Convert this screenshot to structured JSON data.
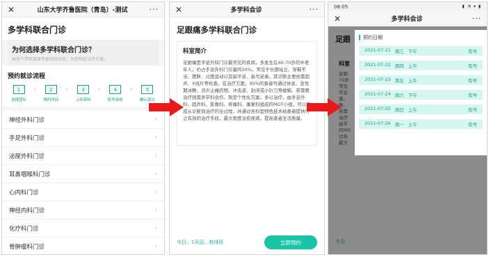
{
  "panel1": {
    "window_title": "山东大学齐鲁医院（青岛）-测试",
    "page_title": "多学科联合门诊",
    "why": {
      "question": "为何选择多学科联合门诊？",
      "desc": "由多个学科资深专家共同讨论，为您制定诊疗方案。"
    },
    "flow": {
      "title": "预约就诊流程",
      "steps": [
        {
          "num": "1",
          "label": "选择团队"
        },
        {
          "num": "2",
          "label": "预约时间"
        },
        {
          "num": "3",
          "label": "上传资料"
        },
        {
          "num": "4",
          "label": "轮号审核"
        },
        {
          "num": "5",
          "label": "确认就诊"
        }
      ],
      "arrow": "»"
    },
    "departments": [
      "神经外科门诊",
      "手足外科门诊",
      "泌尿外科门诊",
      "耳鼻咽喉科门诊",
      "心内科门诊",
      "神经内科门诊",
      "化疗科门诊",
      "骨肿瘤科门诊"
    ],
    "chevron": "›"
  },
  "panel2": {
    "window_title": "多学科会诊",
    "page_title": "足跟痛多学科联合门诊",
    "card_heading": "科室简介",
    "card_text": "足跟痛是手足外科门诊最常见的疾病，多发生在40-70岁的中老年人，约占手足外科门诊量的20%。常见于长期站立、穿鞋不当、肥胖、过度运动以及扁平足、高弓足者。其诊断主要依靠超声、X线片等检查。在治疗方面，95%的患者可通过休息、急性期冰敷、消炎止痛药物、冲击波、封闭或小针刀等缓解。若需要治疗则需多学科合作，制定个性化方案，多以治疗。由手足外科、超声科、影像科、疼痛科、康复科组成的MDT小组，可以完成从诊断到治疗的全过程，并通过各科室特色技术给患者提供行之有效的治疗手段，最大限度治愈疾病，提高患者生活质量。",
    "footer_hint": "今日、1天后...有排班",
    "book_button": "立即预约"
  },
  "panel3": {
    "status_time": "08:05",
    "status_icons": "▮ ◔ ▾ ▮",
    "window_title": "多学科会诊",
    "bg_title_fragment": "足跟",
    "bg_heading_fragment": "科室",
    "bg_text_lines": [
      "足跟",
      "70岁",
      "常见",
      "平足",
      "查。",
      "敷、",
      "若需",
      "治疗",
      "由手",
      "的MD",
      "过各",
      "最大"
    ],
    "bg_footer_fragment": "今日",
    "sheet_heading": "预约日期",
    "dates": [
      {
        "date": "2021-07-21",
        "weekday": "周三",
        "period": "下午",
        "status": "有号"
      },
      {
        "date": "2021-07-22",
        "weekday": "周四",
        "period": "上午",
        "status": "有号"
      },
      {
        "date": "2021-07-23",
        "weekday": "周五",
        "period": "上午",
        "status": "有号"
      },
      {
        "date": "2021-07-24",
        "weekday": "周六",
        "period": "下午",
        "status": "有号"
      },
      {
        "date": "2021-07-25",
        "weekday": "周日",
        "period": "上午",
        "status": "有号"
      },
      {
        "date": "2021-07-26",
        "weekday": "周一",
        "period": "上午",
        "status": "有号"
      }
    ]
  },
  "common": {
    "close_glyph": "✕",
    "more_glyph": "···"
  },
  "colors": {
    "accent": "#19c3a6",
    "accent_text": "#16a085",
    "arrow_red": "#e81a1a",
    "date_bg": "#d5f7f0"
  }
}
